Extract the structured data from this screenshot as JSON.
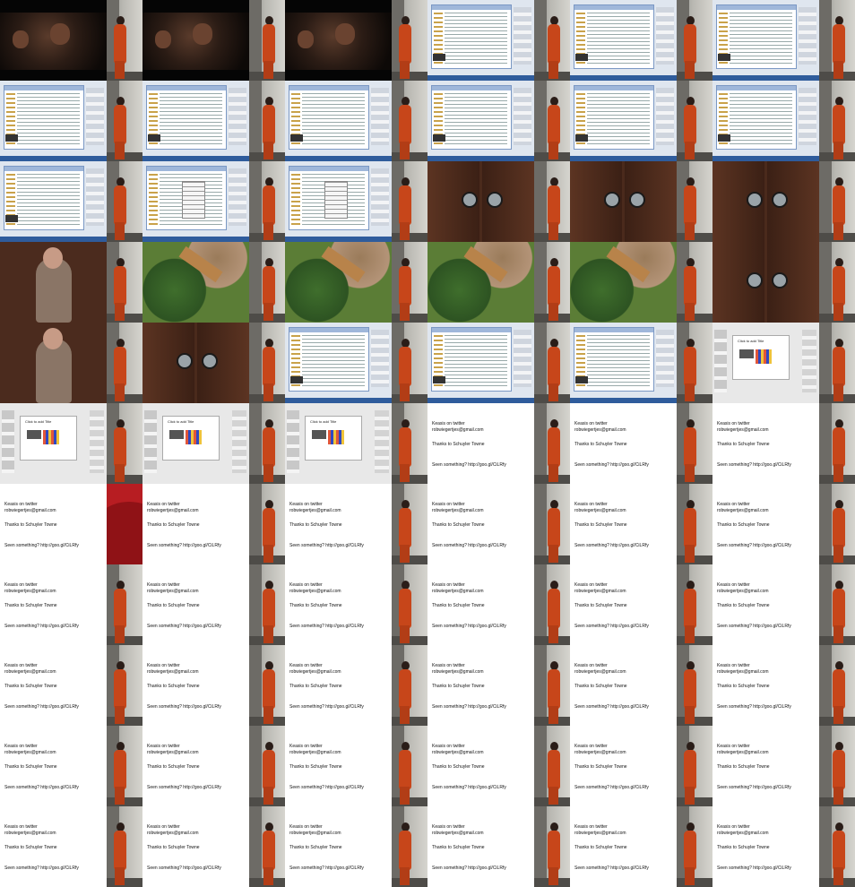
{
  "grid": {
    "columns": 6,
    "rows": 11
  },
  "colors": {
    "suit": "#c7461a",
    "slide_bg": "#ffffff",
    "wall": "#b9b8b2"
  },
  "final_slide": {
    "bullets": [
      "Keasis on twitter",
      "robwiegertjes@gmail.com",
      "Thanks to Schuyler Towne",
      "Seen something? http://goo.gl/CiLRfy"
    ]
  },
  "pres_slide": {
    "title": "Click to add Title"
  },
  "cells": [
    "film",
    "film",
    "film-desk",
    "desk",
    "desk",
    "desk",
    "desk",
    "desk",
    "desk",
    "desk",
    "desk",
    "desk",
    "desk",
    "menu",
    "menu",
    "door-desk",
    "door",
    "door",
    "man",
    "garden",
    "garden",
    "garden",
    "garden",
    "door-man",
    "man",
    "door",
    "desk-door",
    "desk-door",
    "desk",
    "pres",
    "pres",
    "pres",
    "pres-list",
    "text",
    "text",
    "text",
    "text-red",
    "text",
    "text",
    "text",
    "text",
    "text",
    "text",
    "text",
    "text",
    "text",
    "text",
    "text",
    "text",
    "text",
    "text",
    "text",
    "text",
    "text",
    "text",
    "text",
    "text",
    "text",
    "text",
    "text",
    "text",
    "text",
    "text",
    "text",
    "text",
    "text"
  ],
  "special_cam": {
    "0": "none",
    "30": "red"
  }
}
